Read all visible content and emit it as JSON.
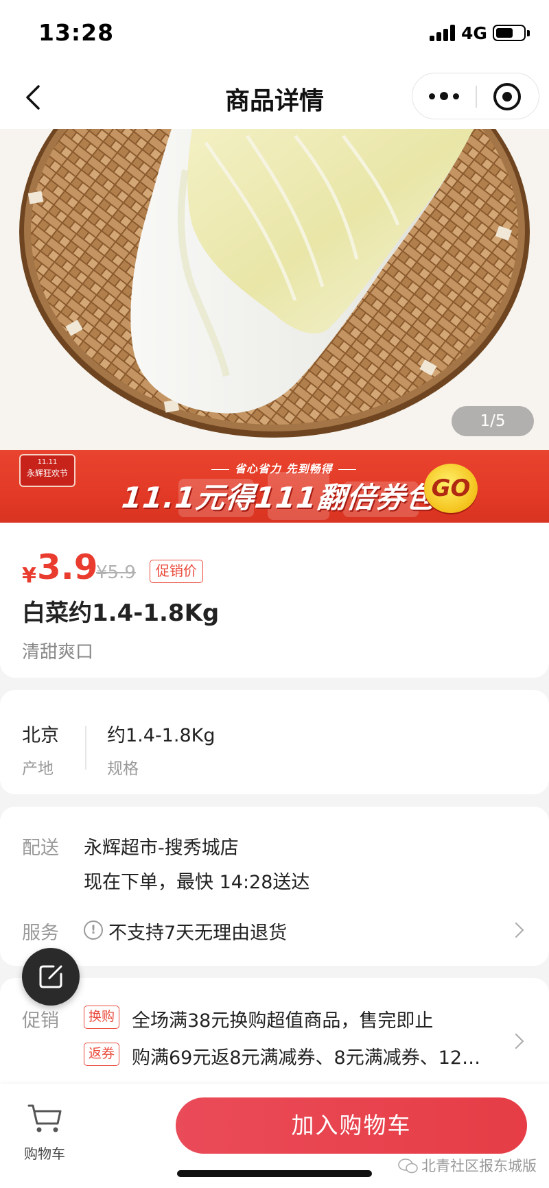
{
  "status_bar": {
    "time": "13:28",
    "network": "4G",
    "battery_level": 0.62
  },
  "nav": {
    "title": "商品详情"
  },
  "gallery": {
    "page_indicator": "1/5"
  },
  "banner": {
    "badge_line1": "11.11",
    "badge_line2": "永辉狂欢节",
    "subline": "省心省力 先到畅得",
    "headline": "11.1元得111翻倍券包",
    "go_label": "GO"
  },
  "product": {
    "price_symbol": "¥",
    "price": "3.9",
    "original_price": "¥5.9",
    "price_tag": "促销价",
    "name": "白菜约1.4-1.8Kg",
    "subtitle": "清甜爽口"
  },
  "specs": [
    {
      "value": "北京",
      "label": "产地"
    },
    {
      "value": "约1.4-1.8Kg",
      "label": "规格"
    }
  ],
  "delivery": {
    "label": "配送",
    "store": "永辉超市-搜秀城店",
    "eta": "现在下单，最快 14:28送达",
    "service_label": "服务",
    "service_icon": "!",
    "service_text": "不支持7天无理由退货"
  },
  "promotion": {
    "label": "促销",
    "items": [
      {
        "tag": "换购",
        "text": "全场满38元换购超值商品，售完即止"
      },
      {
        "tag": "返券",
        "text": "购满69元返8元满减券、8元满减券、12…"
      }
    ]
  },
  "bottom_bar": {
    "cart_label": "购物车",
    "add_to_cart": "加入购物车",
    "watermark": "北青社区报东城版"
  },
  "colors": {
    "accent": "#e93b2e",
    "button": "#e63d46",
    "banner": "#e23a26"
  }
}
